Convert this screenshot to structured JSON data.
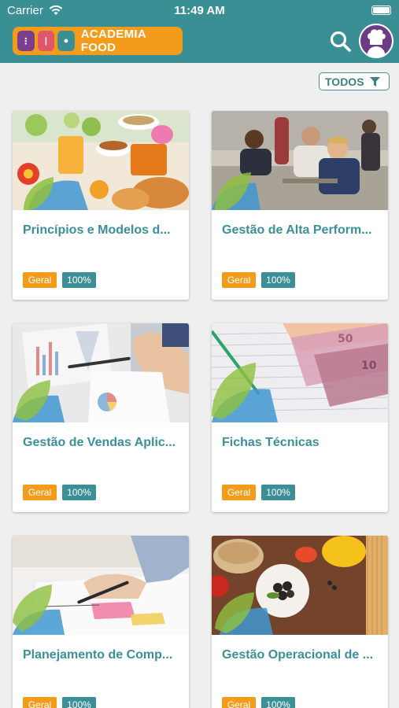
{
  "status_bar": {
    "carrier": "Carrier",
    "time": "11:49 AM"
  },
  "header": {
    "logo_text": "ACADEMIA FOOD"
  },
  "filter": {
    "label": "TODOS"
  },
  "colors": {
    "header": "#3a8f94",
    "accent": "#f39c1b",
    "title": "#3a8f9b",
    "badge_teal": "#3c8f97"
  },
  "courses": [
    {
      "title": "Princípios e Modelos d...",
      "category": "Geral",
      "progress": "100%",
      "image": "breakfast-table"
    },
    {
      "title": "Gestão de Alta Perform...",
      "category": "Geral",
      "progress": "100%",
      "image": "people-meeting"
    },
    {
      "title": "Gestão de Vendas Aplic...",
      "category": "Geral",
      "progress": "100%",
      "image": "sales-charts"
    },
    {
      "title": "Fichas Técnicas",
      "category": "Geral",
      "progress": "100%",
      "image": "money-spreadsheet"
    },
    {
      "title": "Planejamento de Comp...",
      "category": "Geral",
      "progress": "100%",
      "image": "planning-desk"
    },
    {
      "title": "Gestão Operacional de ...",
      "category": "Geral",
      "progress": "100%",
      "image": "vegetables-board"
    }
  ]
}
